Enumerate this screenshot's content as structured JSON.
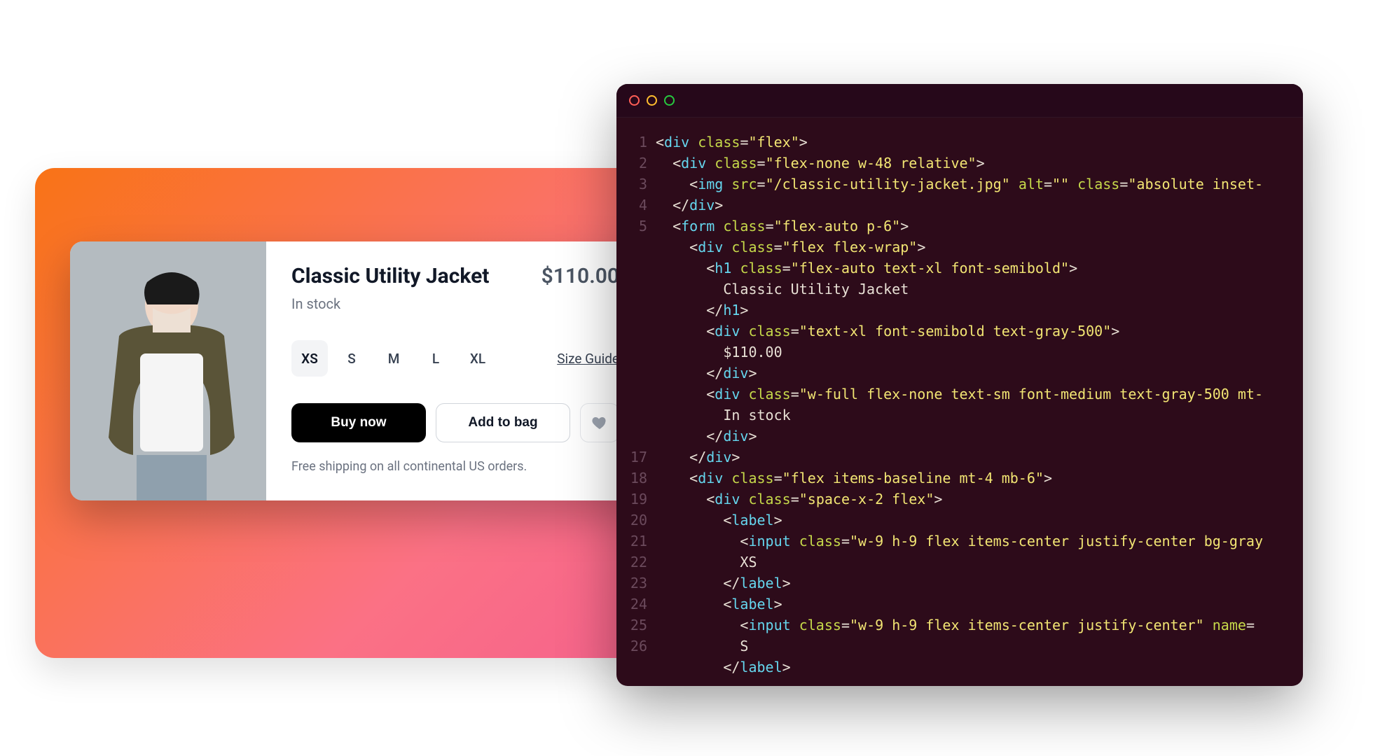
{
  "product": {
    "title": "Classic Utility Jacket",
    "price": "$110.00",
    "stock": "In stock",
    "sizes": [
      "XS",
      "S",
      "M",
      "L",
      "XL"
    ],
    "selected_size_index": 0,
    "size_guide_label": "Size Guide",
    "buy_now_label": "Buy now",
    "add_to_bag_label": "Add to bag",
    "shipping_note": "Free shipping on all continental US orders."
  },
  "code": {
    "line_numbers": [
      "1",
      "2",
      "3",
      "4",
      "5",
      "",
      "",
      "",
      "",
      "",
      "",
      "",
      "",
      "",
      "",
      "17",
      "18",
      "19",
      "20",
      "21",
      "22",
      "23",
      "24",
      "25",
      "26"
    ],
    "lines": [
      [
        {
          "t": "br",
          "v": "<"
        },
        {
          "t": "tag",
          "v": "div"
        },
        {
          "t": "br",
          "v": " "
        },
        {
          "t": "attr",
          "v": "class"
        },
        {
          "t": "eq",
          "v": "="
        },
        {
          "t": "str",
          "v": "\"flex\""
        },
        {
          "t": "br",
          "v": ">"
        }
      ],
      [
        {
          "t": "br",
          "v": "  <"
        },
        {
          "t": "tag",
          "v": "div"
        },
        {
          "t": "br",
          "v": " "
        },
        {
          "t": "attr",
          "v": "class"
        },
        {
          "t": "eq",
          "v": "="
        },
        {
          "t": "str",
          "v": "\"flex-none w-48 relative\""
        },
        {
          "t": "br",
          "v": ">"
        }
      ],
      [
        {
          "t": "br",
          "v": "    <"
        },
        {
          "t": "tag",
          "v": "img"
        },
        {
          "t": "br",
          "v": " "
        },
        {
          "t": "attr",
          "v": "src"
        },
        {
          "t": "eq",
          "v": "="
        },
        {
          "t": "str",
          "v": "\"/classic-utility-jacket.jpg\""
        },
        {
          "t": "br",
          "v": " "
        },
        {
          "t": "attr",
          "v": "alt"
        },
        {
          "t": "eq",
          "v": "="
        },
        {
          "t": "str",
          "v": "\"\""
        },
        {
          "t": "br",
          "v": " "
        },
        {
          "t": "attr",
          "v": "class"
        },
        {
          "t": "eq",
          "v": "="
        },
        {
          "t": "str",
          "v": "\"absolute inset-"
        }
      ],
      [
        {
          "t": "br",
          "v": "  </"
        },
        {
          "t": "tag",
          "v": "div"
        },
        {
          "t": "br",
          "v": ">"
        }
      ],
      [
        {
          "t": "br",
          "v": "  <"
        },
        {
          "t": "tag",
          "v": "form"
        },
        {
          "t": "br",
          "v": " "
        },
        {
          "t": "attr",
          "v": "class"
        },
        {
          "t": "eq",
          "v": "="
        },
        {
          "t": "str",
          "v": "\"flex-auto p-6\""
        },
        {
          "t": "br",
          "v": ">"
        }
      ],
      [
        {
          "t": "br",
          "v": "    <"
        },
        {
          "t": "tag",
          "v": "div"
        },
        {
          "t": "br",
          "v": " "
        },
        {
          "t": "attr",
          "v": "class"
        },
        {
          "t": "eq",
          "v": "="
        },
        {
          "t": "str",
          "v": "\"flex flex-wrap\""
        },
        {
          "t": "br",
          "v": ">"
        }
      ],
      [
        {
          "t": "br",
          "v": "      <"
        },
        {
          "t": "tag",
          "v": "h1"
        },
        {
          "t": "br",
          "v": " "
        },
        {
          "t": "attr",
          "v": "class"
        },
        {
          "t": "eq",
          "v": "="
        },
        {
          "t": "str",
          "v": "\"flex-auto text-xl font-semibold\""
        },
        {
          "t": "br",
          "v": ">"
        }
      ],
      [
        {
          "t": "br",
          "v": "        Classic Utility Jacket"
        }
      ],
      [
        {
          "t": "br",
          "v": "      </"
        },
        {
          "t": "tag",
          "v": "h1"
        },
        {
          "t": "br",
          "v": ">"
        }
      ],
      [
        {
          "t": "br",
          "v": "      <"
        },
        {
          "t": "tag",
          "v": "div"
        },
        {
          "t": "br",
          "v": " "
        },
        {
          "t": "attr",
          "v": "class"
        },
        {
          "t": "eq",
          "v": "="
        },
        {
          "t": "str",
          "v": "\"text-xl font-semibold text-gray-500\""
        },
        {
          "t": "br",
          "v": ">"
        }
      ],
      [
        {
          "t": "br",
          "v": "        $110.00"
        }
      ],
      [
        {
          "t": "br",
          "v": "      </"
        },
        {
          "t": "tag",
          "v": "div"
        },
        {
          "t": "br",
          "v": ">"
        }
      ],
      [
        {
          "t": "br",
          "v": "      <"
        },
        {
          "t": "tag",
          "v": "div"
        },
        {
          "t": "br",
          "v": " "
        },
        {
          "t": "attr",
          "v": "class"
        },
        {
          "t": "eq",
          "v": "="
        },
        {
          "t": "str",
          "v": "\"w-full flex-none text-sm font-medium text-gray-500 mt-"
        }
      ],
      [
        {
          "t": "br",
          "v": "        In stock"
        }
      ],
      [
        {
          "t": "br",
          "v": "      </"
        },
        {
          "t": "tag",
          "v": "div"
        },
        {
          "t": "br",
          "v": ">"
        }
      ],
      [
        {
          "t": "br",
          "v": "    </"
        },
        {
          "t": "tag",
          "v": "div"
        },
        {
          "t": "br",
          "v": ">"
        }
      ],
      [
        {
          "t": "br",
          "v": "    <"
        },
        {
          "t": "tag",
          "v": "div"
        },
        {
          "t": "br",
          "v": " "
        },
        {
          "t": "attr",
          "v": "class"
        },
        {
          "t": "eq",
          "v": "="
        },
        {
          "t": "str",
          "v": "\"flex items-baseline mt-4 mb-6\""
        },
        {
          "t": "br",
          "v": ">"
        }
      ],
      [
        {
          "t": "br",
          "v": "      <"
        },
        {
          "t": "tag",
          "v": "div"
        },
        {
          "t": "br",
          "v": " "
        },
        {
          "t": "attr",
          "v": "class"
        },
        {
          "t": "eq",
          "v": "="
        },
        {
          "t": "str",
          "v": "\"space-x-2 flex\""
        },
        {
          "t": "br",
          "v": ">"
        }
      ],
      [
        {
          "t": "br",
          "v": "        <"
        },
        {
          "t": "tag",
          "v": "label"
        },
        {
          "t": "br",
          "v": ">"
        }
      ],
      [
        {
          "t": "br",
          "v": "          <"
        },
        {
          "t": "tag",
          "v": "input"
        },
        {
          "t": "br",
          "v": " "
        },
        {
          "t": "attr",
          "v": "class"
        },
        {
          "t": "eq",
          "v": "="
        },
        {
          "t": "str",
          "v": "\"w-9 h-9 flex items-center justify-center bg-gray"
        }
      ],
      [
        {
          "t": "br",
          "v": "          XS"
        }
      ],
      [
        {
          "t": "br",
          "v": "        </"
        },
        {
          "t": "tag",
          "v": "label"
        },
        {
          "t": "br",
          "v": ">"
        }
      ],
      [
        {
          "t": "br",
          "v": "        <"
        },
        {
          "t": "tag",
          "v": "label"
        },
        {
          "t": "br",
          "v": ">"
        }
      ],
      [
        {
          "t": "br",
          "v": "          <"
        },
        {
          "t": "tag",
          "v": "input"
        },
        {
          "t": "br",
          "v": " "
        },
        {
          "t": "attr",
          "v": "class"
        },
        {
          "t": "eq",
          "v": "="
        },
        {
          "t": "str",
          "v": "\"w-9 h-9 flex items-center justify-center\""
        },
        {
          "t": "br",
          "v": " "
        },
        {
          "t": "attr",
          "v": "name"
        },
        {
          "t": "eq",
          "v": "="
        }
      ],
      [
        {
          "t": "br",
          "v": "          S"
        }
      ],
      [
        {
          "t": "br",
          "v": "        </"
        },
        {
          "t": "tag",
          "v": "label"
        },
        {
          "t": "br",
          "v": ">"
        }
      ]
    ]
  }
}
